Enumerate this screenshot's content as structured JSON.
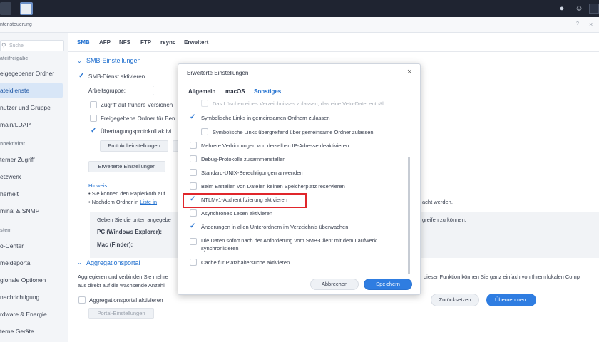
{
  "window": {
    "title": "ntensteuerung",
    "help": "?",
    "close": "×"
  },
  "sidebar": {
    "search_placeholder": "Suche",
    "section_freigabe": "ateifreigabe",
    "section_konnektivitaet": "nnektivität",
    "section_system": "stem",
    "items": [
      "eigegebener Ordner",
      "ateidienste",
      "nutzer und Gruppe",
      "main/LDAP",
      "terner Zugriff",
      "etzwerk",
      "herheit",
      "minal & SNMP",
      "o-Center",
      "meldeportal",
      "gionale Optionen",
      "nachrichtigung",
      "rdware & Energie",
      "terne Geräte"
    ]
  },
  "tabs": [
    "SMB",
    "AFP",
    "NFS",
    "FTP",
    "rsync",
    "Erweitert"
  ],
  "smb": {
    "heading": "SMB-Einstellungen",
    "enable": "SMB-Dienst aktivieren",
    "workgroup_label": "Arbeitsgruppe:",
    "prev_versions": "Zugriff auf frühere Versionen",
    "shared_folder": "Freigegebene Ordner für Ben",
    "transfer_log": "Übertragungsprotokoll aktivi",
    "protocol_btn": "Protokolleinstellungen",
    "advanced_btn": "Erweiterte Einstellungen",
    "hint_label": "Hinweis:",
    "hint1": "Sie können den Papierkorb auf",
    "hint2_a": "Nachdem Ordner in",
    "hint2_link": "Liste in",
    "hint2_end": "acht werden.",
    "info_line": "Geben Sie die unten angegebe",
    "info_end": "greifen zu können:",
    "pc_label": "PC (Windows Explorer):",
    "mac_label": "Mac (Finder):"
  },
  "aggregation": {
    "heading": "Aggregationsportal",
    "desc1": "Aggregieren und verbinden Sie mehre",
    "desc1_end": "dieser Funktion können Sie ganz einfach von Ihrem lokalen Comp",
    "desc2": "aus direkt auf die wachsende Anzahl",
    "enable": "Aggregationsportal aktivieren",
    "portal_btn": "Portal-Einstellungen"
  },
  "footer": {
    "reset": "Zurücksetzen",
    "apply": "Übernehmen"
  },
  "dialog": {
    "title": "Erweiterte Einstellungen",
    "close": "×",
    "tabs": [
      "Allgemein",
      "macOS",
      "Sonstiges"
    ],
    "options": [
      {
        "label": "Das Löschen eines Verzeichnisses zulassen, das eine Veto-Datei enthält",
        "checked": false,
        "faded": true
      },
      {
        "label": "Symbolische Links in gemeinsamen Ordnern zulassen",
        "checked": true
      },
      {
        "label": "Symbolische Links übergreifend über gemeinsame Ordner zulassen",
        "checked": false
      },
      {
        "label": "Mehrere Verbindungen von derselben IP-Adresse deaktivieren",
        "checked": false
      },
      {
        "label": "Debug-Protokolle zusammenstellen",
        "checked": false
      },
      {
        "label": "Standard-UNIX-Berechtigungen anwenden",
        "checked": false
      },
      {
        "label": "Beim Erstellen von Dateien keinen Speicherplatz reservieren",
        "checked": false
      },
      {
        "label": "NTLMv1-Authentifizierung aktivieren",
        "checked": true
      },
      {
        "label": "Asynchrones Lesen aktivieren",
        "checked": false
      },
      {
        "label": "Änderungen in allen Unterordnern im Verzeichnis überwachen",
        "checked": true
      },
      {
        "label": "Die Daten sofort nach der Anforderung vom SMB-Client mit dem Laufwerk",
        "label2": "synchronisieren",
        "checked": false
      },
      {
        "label": "Cache für Platzhaltersuche aktivieren",
        "checked": false
      }
    ],
    "cancel": "Abbrechen",
    "save": "Speichern"
  },
  "colors": {
    "accent": "#1f6fcf",
    "highlight_border": "#e0262b",
    "primary_button": "#2f7de1"
  }
}
